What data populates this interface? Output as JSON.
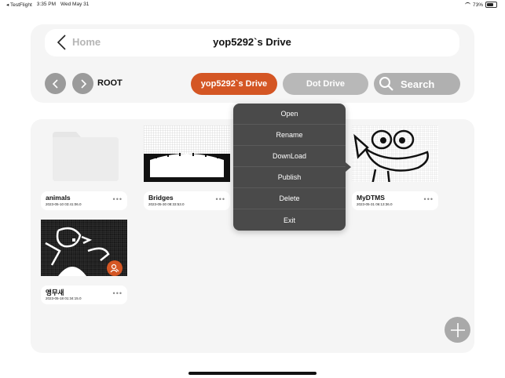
{
  "status_bar": {
    "app": "◂ TestFlight",
    "time": "3:35 PM",
    "date": "Wed May 31",
    "battery": "73%",
    "battery_fraction": 0.73
  },
  "header": {
    "back_label": "Home",
    "title": "yop5292`s Drive"
  },
  "toolbar": {
    "path_label": "ROOT",
    "drive_tabs": [
      {
        "label": "yop5292`s Drive",
        "active": true
      },
      {
        "label": "Dot Drive",
        "active": false
      }
    ],
    "search_label": "Search"
  },
  "files": [
    {
      "name": "animals",
      "date": "2023-05-10 03:41:06.0",
      "type": "folder"
    },
    {
      "name": "Bridges",
      "date": "2023-05-30 08:33:53.0",
      "type": "image"
    },
    {
      "name": "MyDTMS",
      "date": "2023-05-31 06:13:36.0",
      "type": "image"
    },
    {
      "name": "앵무새",
      "date": "2023-05-18 01:34:15.0",
      "type": "image",
      "shared": true
    }
  ],
  "more_label": "•••",
  "context_menu": {
    "items": [
      "Open",
      "Rename",
      "DownLoad",
      "Publish",
      "Delete",
      "Exit"
    ]
  },
  "colors": {
    "accent": "#d45624",
    "menu_bg": "#4a4a4a",
    "panel_bg": "#f5f5f5"
  }
}
